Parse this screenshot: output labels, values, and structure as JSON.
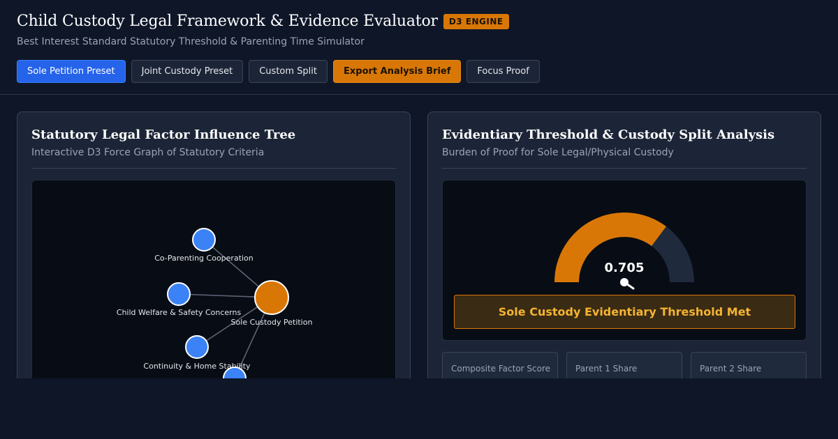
{
  "header": {
    "title": "Child Custody Legal Framework & Evidence Evaluator",
    "badge": "D3 ENGINE",
    "subtitle": "Best Interest Standard Statutory Threshold & Parenting Time Simulator"
  },
  "toolbar": {
    "buttons": [
      {
        "label": "Sole Petition Preset"
      },
      {
        "label": "Joint Custody Preset"
      },
      {
        "label": "Custom Split"
      },
      {
        "label": "Export Analysis Brief"
      },
      {
        "label": "Focus Proof"
      }
    ]
  },
  "left_panel": {
    "title": "Statutory Legal Factor Influence Tree",
    "subtitle": "Interactive D3 Force Graph of Statutory Criteria",
    "graph": {
      "nodes": [
        {
          "label": "Co-Parenting Cooperation",
          "color": "#3b82f6"
        },
        {
          "label": "Child Welfare & Safety Concerns",
          "color": "#3b82f6"
        },
        {
          "label": "Sole Custody Petition",
          "color": "#d97706"
        },
        {
          "label": "Continuity & Home Stability",
          "color": "#3b82f6"
        }
      ]
    }
  },
  "right_panel": {
    "title": "Evidentiary Threshold & Custody Split Analysis",
    "subtitle": "Burden of Proof for Sole Legal/Physical Custody",
    "gauge": {
      "value": 0.705,
      "value_label": "0.705",
      "fill_color": "#d97706",
      "track_color": "#1f2a3c"
    },
    "status": "Sole Custody Evidentiary Threshold Met",
    "stats": [
      {
        "label": "Composite Factor Score"
      },
      {
        "label": "Parent 1 Share"
      },
      {
        "label": "Parent 2 Share"
      }
    ]
  }
}
